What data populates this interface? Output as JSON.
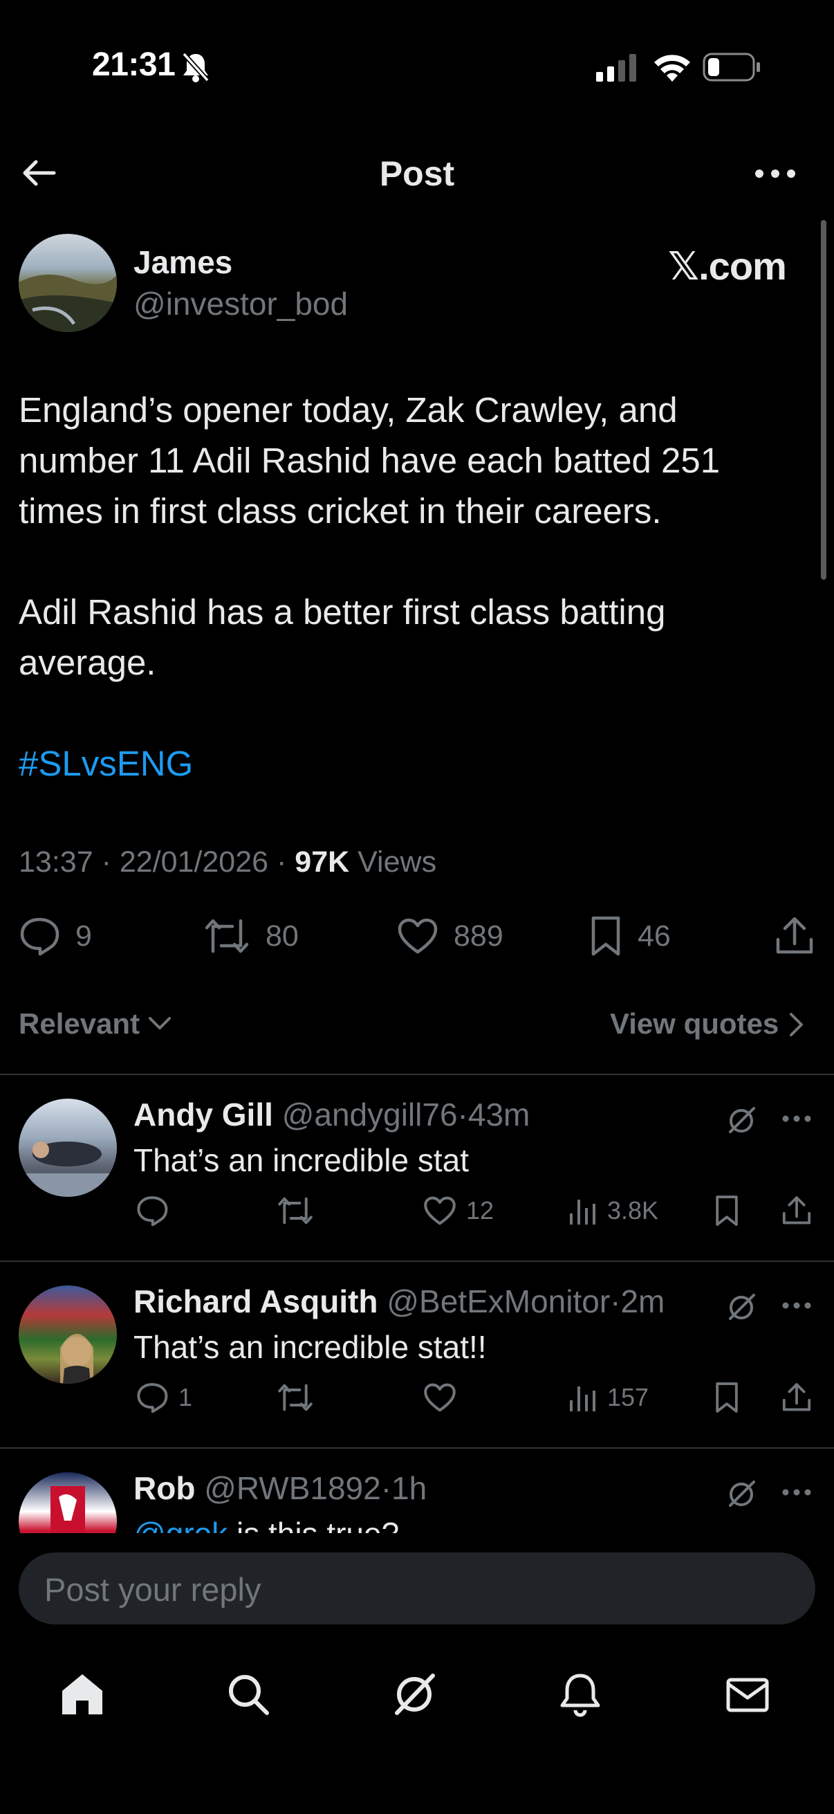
{
  "status_bar": {
    "time": "21:31"
  },
  "header": {
    "title": "Post"
  },
  "post": {
    "author": {
      "name": "James",
      "handle": "@investor_bod"
    },
    "source_label": "𝕏.com",
    "paragraphs": [
      "England’s opener today, Zak Crawley, and number 11 Adil Rashid have each batted 251 times in first class cricket in their careers.",
      "Adil Rashid has a better first class batting average."
    ],
    "hashtag": "#SLvsENG",
    "time": "13:37",
    "date": "22/01/2026",
    "views_count": "97K",
    "views_label": "Views",
    "stats": {
      "replies": "9",
      "reposts": "80",
      "likes": "889",
      "bookmarks": "46"
    }
  },
  "filter": {
    "label": "Relevant",
    "view_quotes": "View quotes"
  },
  "replies": [
    {
      "name": "Andy Gill",
      "handle": "@andygill76",
      "time": "43m",
      "text": "That’s an incredible stat",
      "reply_count": "",
      "repost_count": "",
      "like_count": "12",
      "views": "3.8K"
    },
    {
      "name": "Richard Asquith",
      "handle": "@BetExMonitor",
      "time": "2m",
      "text": "That’s an incredible stat!!",
      "reply_count": "1",
      "repost_count": "",
      "like_count": "",
      "views": "157"
    },
    {
      "name": "Rob",
      "handle": "@RWB1892",
      "time": "1h",
      "mention": "@grok",
      "text": " is this true?"
    }
  ],
  "reply_input": {
    "placeholder": "Post your reply"
  },
  "separator": "·",
  "colors": {
    "background": "#000000",
    "text": "#e7e9ea",
    "secondary": "#71767b",
    "accent": "#1d9bf0",
    "divider": "#2f3336"
  }
}
